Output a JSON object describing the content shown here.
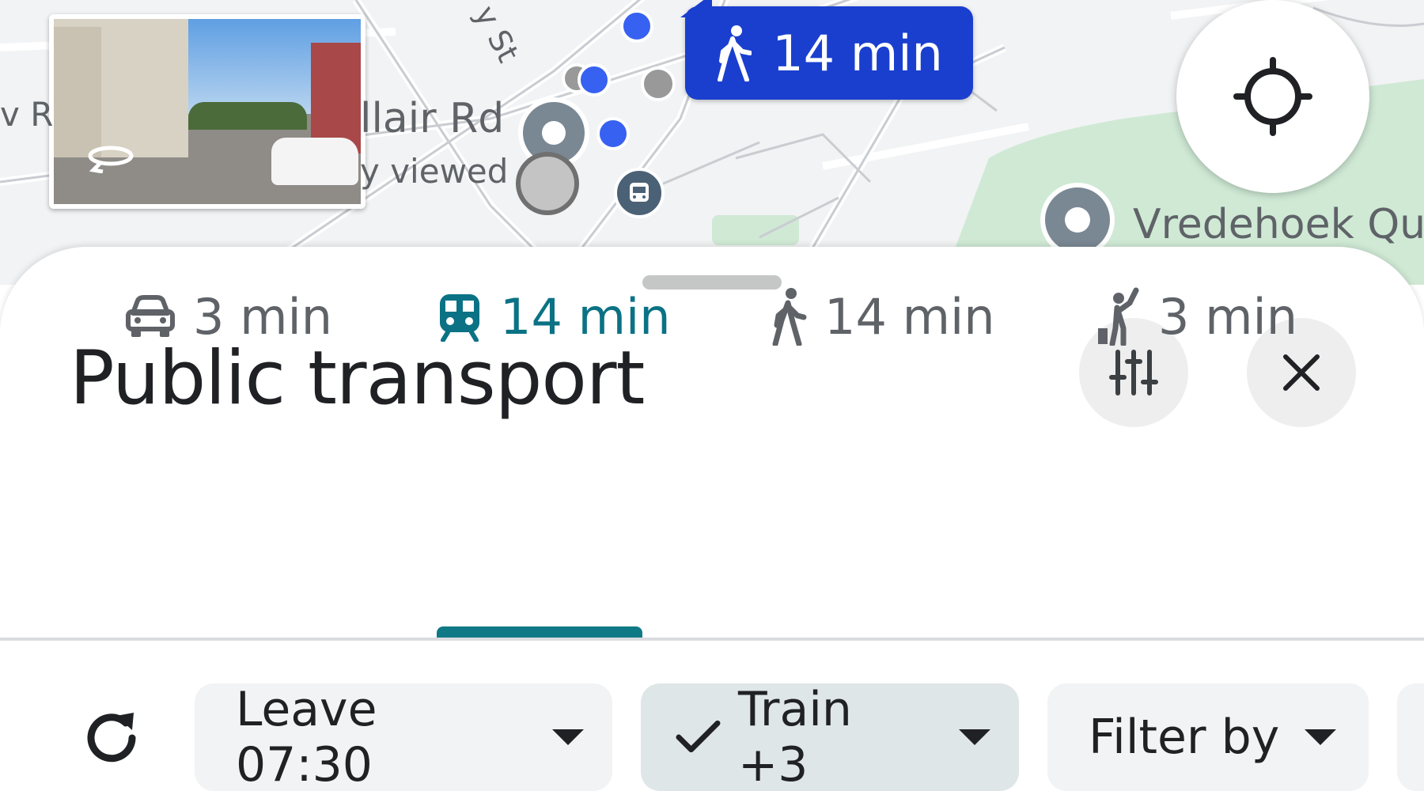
{
  "map": {
    "street_label_1": "llair Rd",
    "street_label_2": "v R",
    "street_label_3": "y St",
    "recent_label": "y viewed",
    "place_label": "Vredehoek Qu",
    "walk_bubble": {
      "text": "14 min",
      "icon": "walking-person-icon",
      "color": "#1a3fcf"
    },
    "streetview_thumbnail": {
      "icon": "rotate-360-icon"
    },
    "locate_button": {
      "icon": "crosshair-icon"
    },
    "bus_stop": {
      "icon": "bus-icon"
    }
  },
  "sheet": {
    "title": "Public transport",
    "options_icon": "sliders-icon",
    "close_icon": "close-icon"
  },
  "modes": [
    {
      "icon": "car-icon",
      "label": "3 min",
      "selected": false
    },
    {
      "icon": "train-icon",
      "label": "14 min",
      "selected": true,
      "accent": "#0b7285"
    },
    {
      "icon": "walking-person-icon",
      "label": "14 min",
      "selected": false
    },
    {
      "icon": "hailing-person-icon",
      "label": "3 min",
      "selected": false
    }
  ],
  "filters": {
    "refresh_icon": "refresh-icon",
    "leave": {
      "label": "Leave 07:30",
      "icon": "caret-down-icon"
    },
    "mode": {
      "label": "Train +3",
      "check_icon": "check-icon",
      "icon": "caret-down-icon"
    },
    "filter_by": {
      "label": "Filter by",
      "icon": "caret-down-icon"
    }
  }
}
